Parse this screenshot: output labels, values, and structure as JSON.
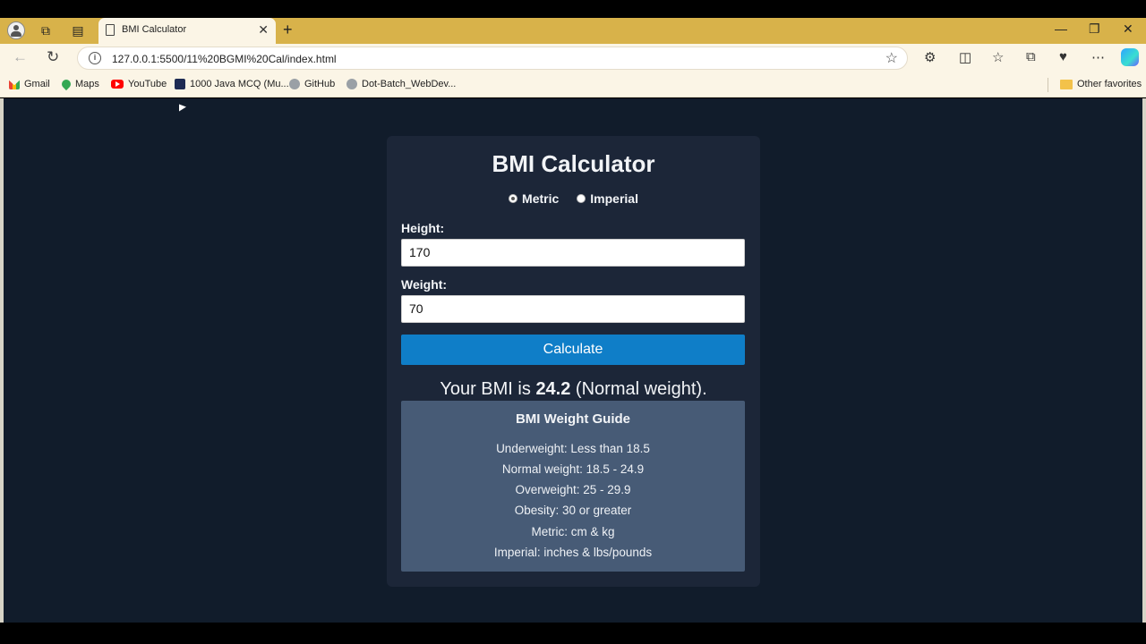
{
  "browser": {
    "tab_title": "BMI Calculator",
    "url": "127.0.0.1:5500/11%20BGMI%20Cal/index.html",
    "bookmarks": [
      {
        "label": "Gmail",
        "icon": "gmail-icon"
      },
      {
        "label": "Maps",
        "icon": "maps-icon"
      },
      {
        "label": "YouTube",
        "icon": "youtube-icon"
      },
      {
        "label": "1000 Java MCQ (Mu...",
        "icon": "java-icon"
      },
      {
        "label": "GitHub",
        "icon": "github-icon"
      },
      {
        "label": "Dot-Batch_WebDev...",
        "icon": "github-icon"
      }
    ],
    "other_favorites": "Other favorites"
  },
  "app": {
    "title": "BMI Calculator",
    "units": {
      "metric": "Metric",
      "imperial": "Imperial",
      "selected": "Metric"
    },
    "height_label": "Height:",
    "height_value": "170",
    "weight_label": "Weight:",
    "weight_value": "70",
    "calculate_label": "Calculate",
    "result": {
      "prefix": "Your BMI is ",
      "value": "24.2",
      "suffix": " (Normal weight)."
    },
    "guide": {
      "title": "BMI Weight Guide",
      "lines": [
        "Underweight: Less than 18.5",
        "Normal weight: 18.5 - 24.9",
        "Overweight: 25 - 29.9",
        "Obesity: 30 or greater",
        "Metric: cm & kg",
        "Imperial: inches & lbs/pounds"
      ]
    }
  },
  "colors": {
    "page_bg": "#111c2b",
    "card_bg": "#1c2638",
    "button": "#0f7ec8",
    "guide_bg": "#475b76",
    "chrome": "#d8b24a"
  }
}
